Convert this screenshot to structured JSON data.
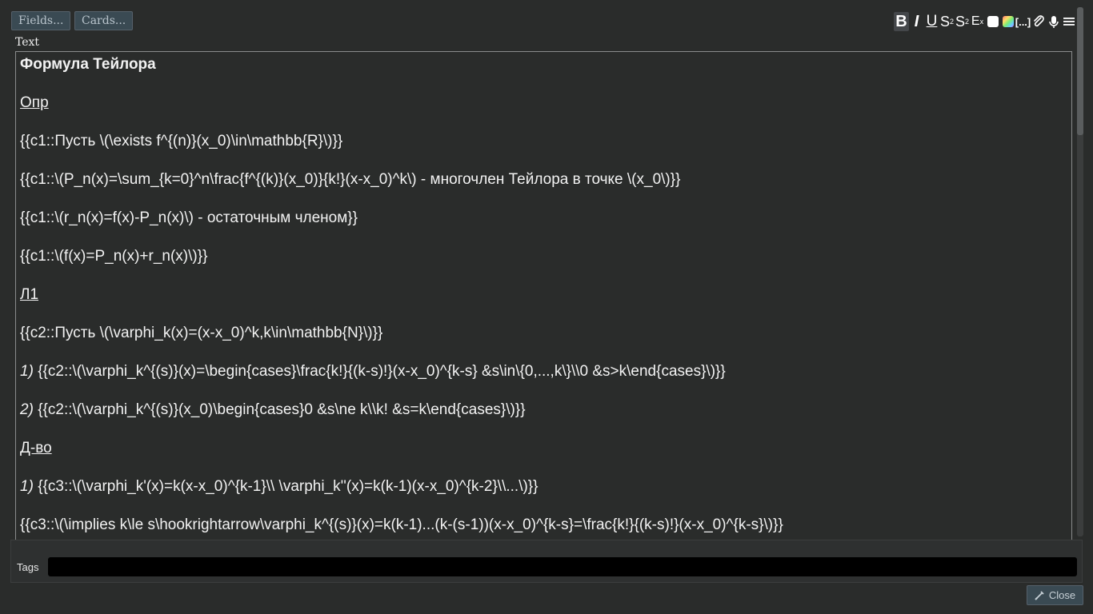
{
  "top_buttons": {
    "fields": "Fields...",
    "cards": "Cards..."
  },
  "toolbar": {
    "bold": "B",
    "italic": "I",
    "underline": "U",
    "superscript": "S",
    "superscript_mark": "2",
    "subscript": "S",
    "subscript_mark": "2",
    "clear_format": "E",
    "clear_format_mark": "x",
    "cloze": "[...]",
    "icons": [
      "bold-icon",
      "italic-icon",
      "underline-icon",
      "superscript-icon",
      "subscript-icon",
      "clear-format-icon",
      "text-color-icon",
      "highlight-color-icon",
      "cloze-icon",
      "attach-icon",
      "record-audio-icon",
      "more-menu-icon"
    ]
  },
  "field": {
    "label": "Text"
  },
  "editor_lines": [
    {
      "text": "Формула Тейлора",
      "num": ""
    },
    {
      "text": "Опр",
      "num": ""
    },
    {
      "text": "{{c1::Пусть \\(\\exists f^{(n)}(x_0)\\in\\mathbb{R}\\)}}",
      "num": ""
    },
    {
      "text": "{{c1::\\(P_n(x)=\\sum_{k=0}^n\\frac{f^{(k)}(x_0)}{k!}(x-x_0)^k\\) - многочлен Тейлора в точке \\(x_0\\)}}",
      "num": ""
    },
    {
      "text": "{{c1::\\(r_n(x)=f(x)-P_n(x)\\) - остаточным членом}}",
      "num": ""
    },
    {
      "text": "{{c1::\\(f(x)=P_n(x)+r_n(x)\\)}}",
      "num": ""
    },
    {
      "text": "Л1",
      "num": ""
    },
    {
      "text": "{{c2::Пусть \\(\\varphi_k(x)=(x-x_0)^k,k\\in\\mathbb{N}\\)}}",
      "num": ""
    },
    {
      "text": "{{c2::\\(\\varphi_k^{(s)}(x)=\\begin{cases}\\frac{k!}{(k-s)!}(x-x_0)^{k-s} &s\\in\\{0,...,k\\}\\\\0 &s>k\\end{cases}\\)}}",
      "num": "1)"
    },
    {
      "text": "{{c2::\\(\\varphi_k^{(s)}(x_0)\\begin{cases}0 &s\\ne k\\\\k! &s=k\\end{cases}\\)}}",
      "num": "2)"
    },
    {
      "text": "Д-во",
      "num": ""
    },
    {
      "text": "{{c3::\\(\\varphi_k'(x)=k(x-x_0)^{k-1}\\\\ \\varphi_k''(x)=k(k-1)(x-x_0)^{k-2}\\\\...\\)}}",
      "num": "1)"
    },
    {
      "text": "{{c3::\\(\\implies k\\le s\\hookrightarrow\\varphi_k^{(s)}(x)=k(k-1)...(k-(s-1))(x-x_0)^{k-s}=\\frac{k!}{(k-s)!}(x-x_0)^{k-s}\\)}}",
      "num": ""
    }
  ],
  "tags": {
    "label": "Tags",
    "value": ""
  },
  "close": {
    "label": "Close"
  }
}
